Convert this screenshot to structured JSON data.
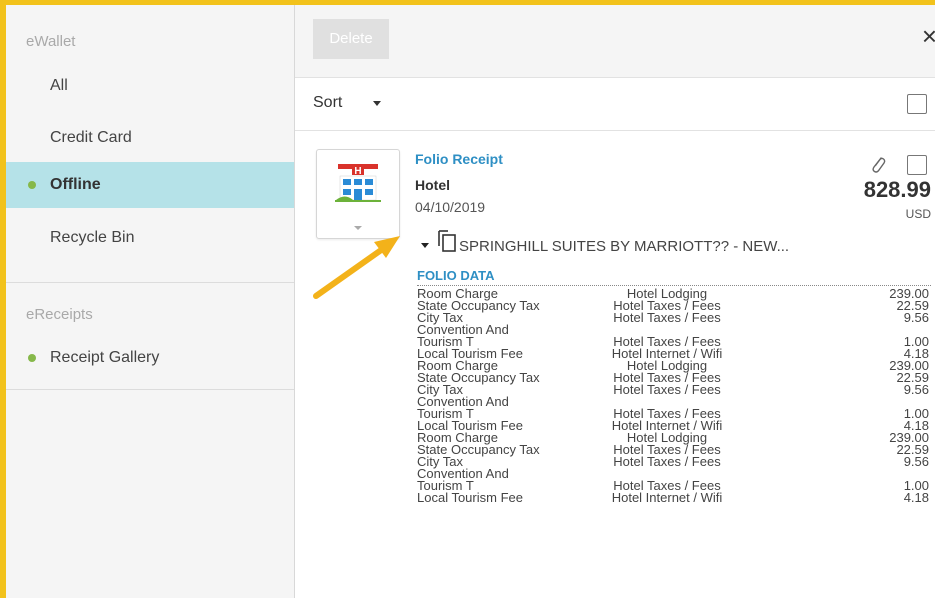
{
  "sidebar": {
    "ewallet_header": "eWallet",
    "items": [
      {
        "label": "All"
      },
      {
        "label": "Credit Card"
      },
      {
        "label": "Offline"
      },
      {
        "label": "Recycle Bin"
      }
    ],
    "ereceipts_header": "eReceipts",
    "ereceipts_items": [
      {
        "label": "Receipt Gallery"
      }
    ]
  },
  "toolbar": {
    "delete_label": "Delete",
    "close_label": "×"
  },
  "sortbar": {
    "sort_label": "Sort"
  },
  "receipt": {
    "title": "Folio Receipt",
    "category": "Hotel",
    "date": "04/10/2019",
    "amount": "828.99",
    "currency": "USD",
    "merchant": "SPRINGHILL SUITES BY MARRIOTT?? - NEW...",
    "folio_header": "FOLIO DATA",
    "folio_rows": [
      {
        "desc": "Room Charge",
        "type": "Hotel Lodging",
        "amount": "239.00"
      },
      {
        "desc": "State Occupancy Tax",
        "type": "Hotel Taxes / Fees",
        "amount": "22.59"
      },
      {
        "desc": "City Tax",
        "type": "Hotel Taxes / Fees",
        "amount": "9.56"
      },
      {
        "desc": "Convention And\nTourism T",
        "type": "Hotel Taxes / Fees",
        "amount": "1.00"
      },
      {
        "desc": "Local Tourism Fee",
        "type": "Hotel Internet / Wifi",
        "amount": "4.18"
      },
      {
        "desc": "Room Charge",
        "type": "Hotel Lodging",
        "amount": "239.00"
      },
      {
        "desc": "State Occupancy Tax",
        "type": "Hotel Taxes / Fees",
        "amount": "22.59"
      },
      {
        "desc": "City Tax",
        "type": "Hotel Taxes / Fees",
        "amount": "9.56"
      },
      {
        "desc": "Convention And\nTourism T",
        "type": "Hotel Taxes / Fees",
        "amount": "1.00"
      },
      {
        "desc": "Local Tourism Fee",
        "type": "Hotel Internet / Wifi",
        "amount": "4.18"
      },
      {
        "desc": "Room Charge",
        "type": "Hotel Lodging",
        "amount": "239.00"
      },
      {
        "desc": "State Occupancy Tax",
        "type": "Hotel Taxes / Fees",
        "amount": "22.59"
      },
      {
        "desc": "City Tax",
        "type": "Hotel Taxes / Fees",
        "amount": "9.56"
      },
      {
        "desc": "Convention And\nTourism T",
        "type": "Hotel Taxes / Fees",
        "amount": "1.00"
      },
      {
        "desc": "Local Tourism Fee",
        "type": "Hotel Internet / Wifi",
        "amount": "4.18"
      }
    ]
  },
  "colors": {
    "accent_blue": "#2e8fc4",
    "active_bg": "#b5e2e8",
    "status_green": "#86b84a",
    "highlight_border": "#f2c21b",
    "arrow_orange": "#f3b21a"
  },
  "icons": [
    "close-icon",
    "chevron-down-icon",
    "checkbox-icon",
    "hotel-icon",
    "paperclip-icon",
    "copy-icon",
    "arrow-annotation-icon"
  ]
}
